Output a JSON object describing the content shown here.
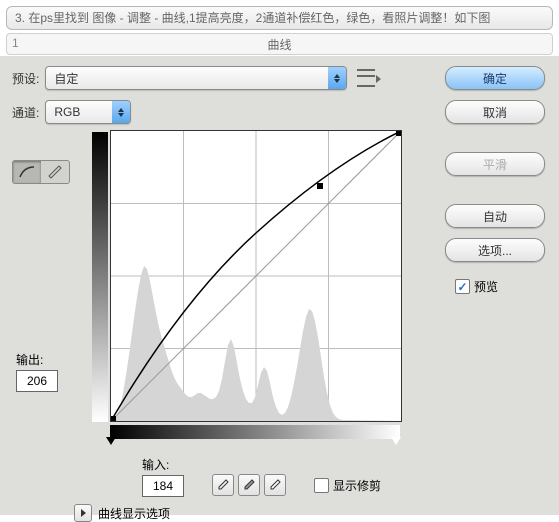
{
  "instruction": "3. 在ps里找到 图像 - 调整 - 曲线,1提高亮度，2通道补偿红色，绿色，看照片调整！如下图",
  "tab": {
    "number": "1",
    "title": "曲线"
  },
  "preset": {
    "label": "预设:",
    "value": "自定"
  },
  "channel": {
    "label": "通道:",
    "value": "RGB"
  },
  "output": {
    "label": "输出:",
    "value": "206"
  },
  "input": {
    "label": "输入:",
    "value": "184"
  },
  "show_clipping": "显示修剪",
  "disclosure": "曲线显示选项",
  "buttons": {
    "ok": "确定",
    "cancel": "取消",
    "smooth": "平滑",
    "auto": "自动",
    "options": "选项..."
  },
  "preview": "预览",
  "icons": {
    "curve_tool": "curve-tool-icon",
    "pencil_tool": "pencil-tool-icon",
    "menu": "menu-icon",
    "eyedrop_black": "eyedropper-black-icon",
    "eyedrop_gray": "eyedropper-gray-icon",
    "eyedrop_white": "eyedropper-white-icon"
  },
  "chart_data": {
    "type": "line",
    "title": "",
    "xlabel": "输入",
    "ylabel": "输出",
    "xlim": [
      0,
      255
    ],
    "ylim": [
      0,
      255
    ],
    "series": [
      {
        "name": "curve",
        "values": [
          [
            0,
            0
          ],
          [
            64,
            95
          ],
          [
            128,
            165
          ],
          [
            184,
            206
          ],
          [
            255,
            255
          ]
        ]
      },
      {
        "name": "baseline",
        "values": [
          [
            0,
            0
          ],
          [
            255,
            255
          ]
        ]
      }
    ],
    "histogram": [
      0,
      0,
      0,
      2,
      6,
      14,
      26,
      40,
      56,
      74,
      90,
      102,
      106,
      100,
      88,
      74,
      62,
      54,
      48,
      42,
      36,
      30,
      26,
      24,
      22,
      20,
      18,
      16,
      15,
      16,
      18,
      20,
      22,
      22,
      20,
      18,
      16,
      14,
      14,
      16,
      22,
      34,
      50,
      62,
      66,
      60,
      48,
      36,
      26,
      18,
      14,
      10,
      8,
      12,
      20,
      30,
      38,
      40,
      34,
      24,
      14,
      8,
      4,
      2,
      1,
      3,
      7,
      14,
      22,
      32,
      44,
      58,
      72,
      82,
      86,
      82,
      72,
      58,
      44,
      32,
      22,
      14,
      8,
      4,
      2,
      1,
      0,
      0,
      0,
      0,
      0,
      0,
      0,
      0,
      0,
      0,
      0,
      0,
      0,
      0
    ],
    "control_point": [
      184,
      206
    ]
  }
}
